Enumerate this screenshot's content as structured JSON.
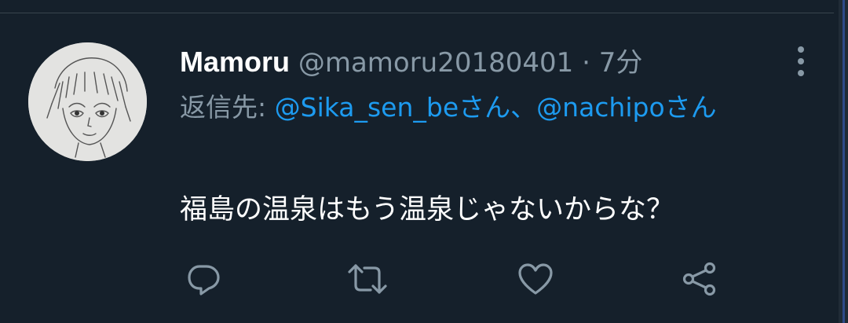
{
  "tweet": {
    "display_name": "Mamoru",
    "handle": "@mamoru20180401",
    "separator": "·",
    "time": "7分",
    "reply_prefix": "返信先:",
    "reply_mention_1": "@Sika_sen_beさん",
    "reply_joiner": "、",
    "reply_mention_2": "@nachipoさん",
    "text": "福島の温泉はもう温泉じゃないからな？"
  },
  "icons": {
    "more": "more-vertical-icon",
    "reply": "reply-icon",
    "retweet": "retweet-icon",
    "like": "like-icon",
    "share": "share-icon"
  },
  "colors": {
    "background": "#15202b",
    "text_primary": "#ffffff",
    "text_secondary": "#8899a6",
    "accent": "#1d9bf0",
    "divider": "#38444d"
  }
}
